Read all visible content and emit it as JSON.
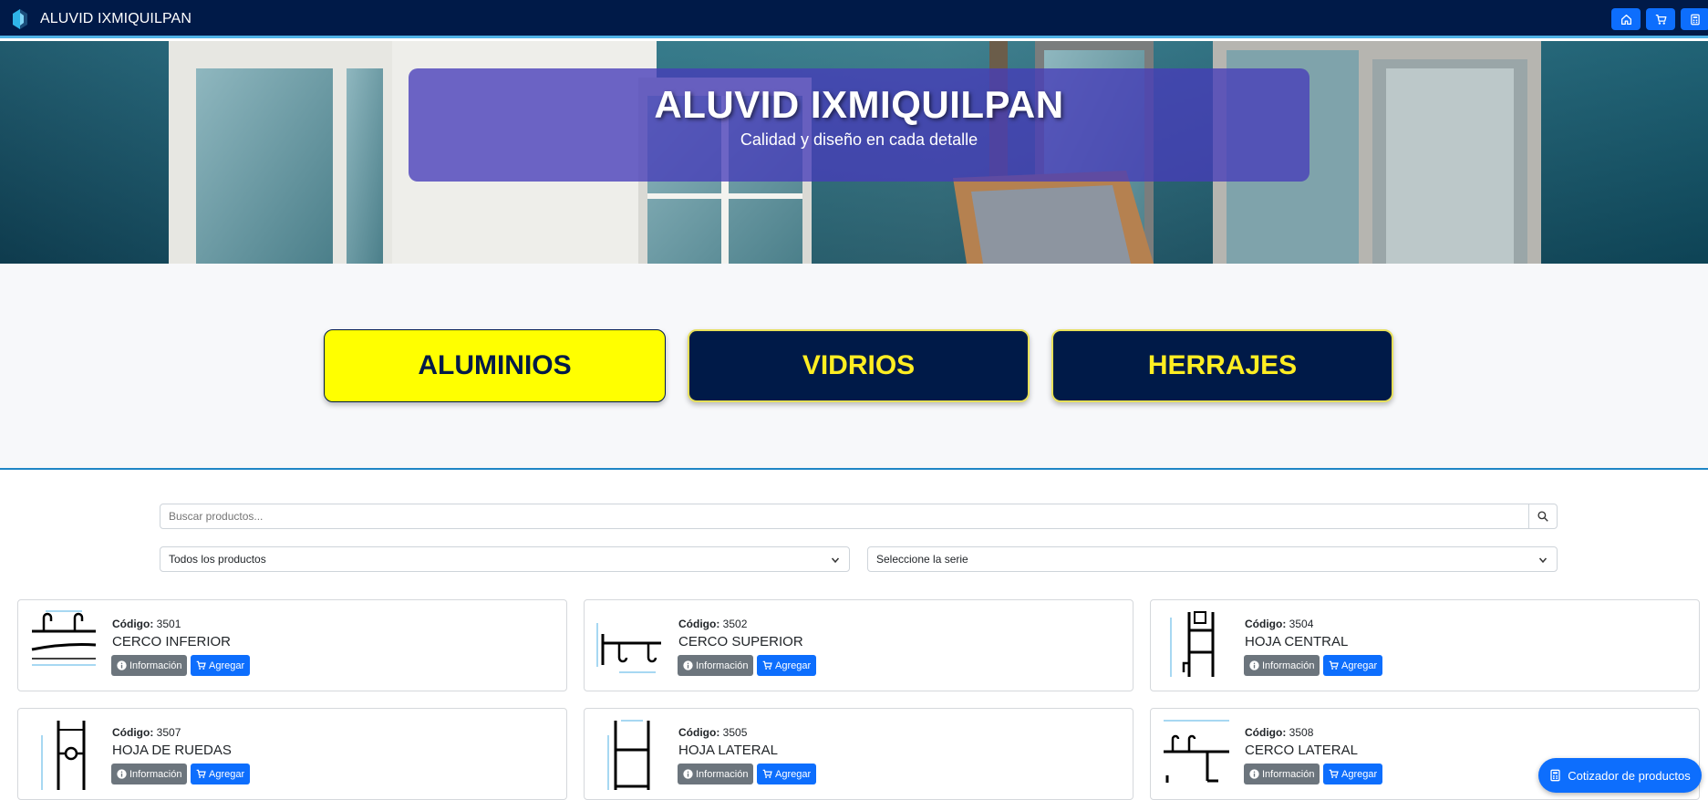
{
  "navbar": {
    "brand": "ALUVID IXMIQUILPAN",
    "icons": [
      "house-icon",
      "cart-icon",
      "calculator-icon"
    ]
  },
  "hero": {
    "title": "ALUVID IXMIQUILPAN",
    "subtitle": "Calidad y diseño en cada detalle"
  },
  "categories": [
    {
      "label": "ALUMINIOS",
      "active": true
    },
    {
      "label": "VIDRIOS",
      "active": false
    },
    {
      "label": "HERRAJES",
      "active": false
    }
  ],
  "search": {
    "placeholder": "Buscar productos..."
  },
  "filters": {
    "product_select": "Todos los productos",
    "series_select": "Seleccione la serie"
  },
  "products": [
    {
      "code_label": "Código:",
      "code": "3501",
      "name": "CERCO INFERIOR",
      "info": "Información",
      "add": "Agregar"
    },
    {
      "code_label": "Código:",
      "code": "3502",
      "name": "CERCO SUPERIOR",
      "info": "Información",
      "add": "Agregar"
    },
    {
      "code_label": "Código:",
      "code": "3504",
      "name": "HOJA CENTRAL",
      "info": "Información",
      "add": "Agregar"
    },
    {
      "code_label": "Código:",
      "code": "3507",
      "name": "HOJA DE RUEDAS",
      "info": "Información",
      "add": "Agregar"
    },
    {
      "code_label": "Código:",
      "code": "3505",
      "name": "HOJA LATERAL",
      "info": "Información",
      "add": "Agregar"
    },
    {
      "code_label": "Código:",
      "code": "3508",
      "name": "CERCO LATERAL",
      "info": "Información",
      "add": "Agregar"
    }
  ],
  "floating_button": {
    "label": "Cotizador de productos"
  },
  "colors": {
    "navbar": "#001a48",
    "accent_yellow": "#ffff00",
    "primary": "#0d6efd",
    "secondary": "#6c757d",
    "hero_box": "#463cb9"
  }
}
